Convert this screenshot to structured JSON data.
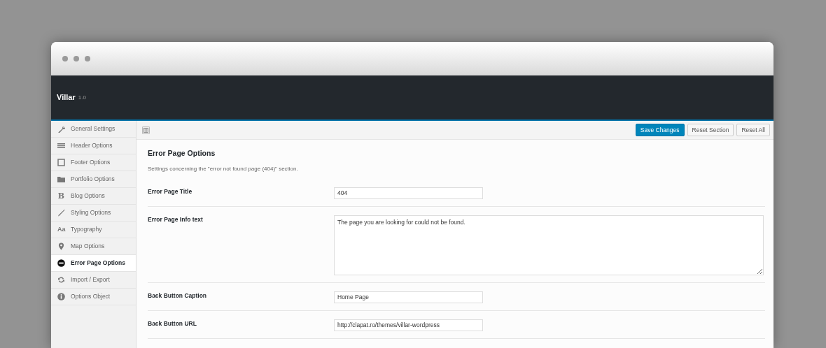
{
  "app": {
    "title": "Villar",
    "version": "1.0"
  },
  "sidebar": {
    "items": [
      {
        "label": "General Settings",
        "selected": false
      },
      {
        "label": "Header Options",
        "selected": false
      },
      {
        "label": "Footer Options",
        "selected": false
      },
      {
        "label": "Portfolio Options",
        "selected": false
      },
      {
        "label": "Blog Options",
        "glyph": "B",
        "selected": false
      },
      {
        "label": "Styling Options",
        "selected": false
      },
      {
        "label": "Typography",
        "glyph": "Aa",
        "selected": false
      },
      {
        "label": "Map Options",
        "selected": false
      },
      {
        "label": "Error Page Options",
        "selected": true
      },
      {
        "label": "Import / Export",
        "selected": false
      },
      {
        "label": "Options Object",
        "selected": false
      }
    ]
  },
  "toolbar": {
    "buttons": [
      {
        "label": "Save Changes",
        "kind": "primary"
      },
      {
        "label": "Reset Section",
        "kind": "default"
      },
      {
        "label": "Reset All",
        "kind": "default"
      }
    ]
  },
  "section": {
    "title": "Error Page Options",
    "description": "Settings concerning the \"error not found page (404)\" section.",
    "fields": [
      {
        "label": "Error Page Title",
        "kind": "text",
        "value": "404"
      },
      {
        "label": "Error Page Info text",
        "kind": "textarea",
        "value": "The page you are looking for could not be found."
      },
      {
        "label": "Back Button Caption",
        "kind": "text",
        "value": "Home Page"
      },
      {
        "label": "Back Button URL",
        "kind": "text",
        "value": "http://clapat.ro/themes/villar-wordpress"
      }
    ]
  }
}
